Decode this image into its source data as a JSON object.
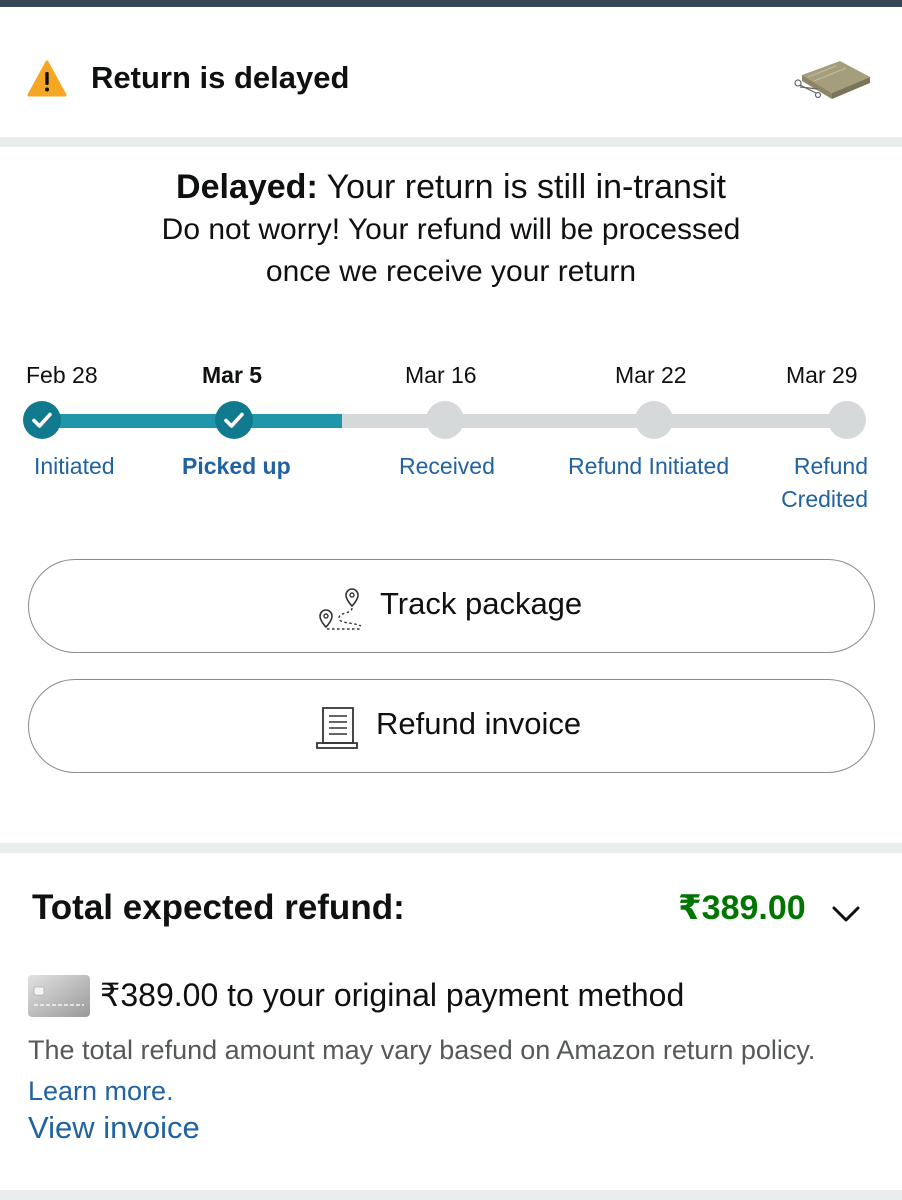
{
  "header": {
    "title": "Return is delayed",
    "icon": "warning-icon",
    "accent": "#f5a623"
  },
  "status": {
    "heading_bold": "Delayed:",
    "heading_rest": " Your return is still in-transit",
    "message_line1": "Do not worry! Your refund will be processed",
    "message_line2": "once we receive your return"
  },
  "timeline": {
    "progress_color": "#1f96a9",
    "steps": [
      {
        "date": "Feb 28",
        "label": "Initiated",
        "done": true,
        "current": false
      },
      {
        "date": "Mar 5",
        "label": "Picked up",
        "done": true,
        "current": true
      },
      {
        "date": "Mar 16",
        "label": "Received",
        "done": false,
        "current": false
      },
      {
        "date": "Mar 22",
        "label": "Refund Initiated",
        "done": false,
        "current": false
      },
      {
        "date": "Mar 29",
        "label_line1": "Refund",
        "label_line2": "Credited",
        "done": false,
        "current": false
      }
    ]
  },
  "actions": {
    "track_package": "Track package",
    "refund_invoice": "Refund invoice"
  },
  "refund": {
    "title": "Total expected refund:",
    "amount": "₹389.00",
    "amount_color": "#007600",
    "method_text": "₹389.00 to your original payment method",
    "policy_text": "The total refund amount may vary based on Amazon return policy. ",
    "learn_more": "Learn more.",
    "view_invoice": "View invoice"
  }
}
